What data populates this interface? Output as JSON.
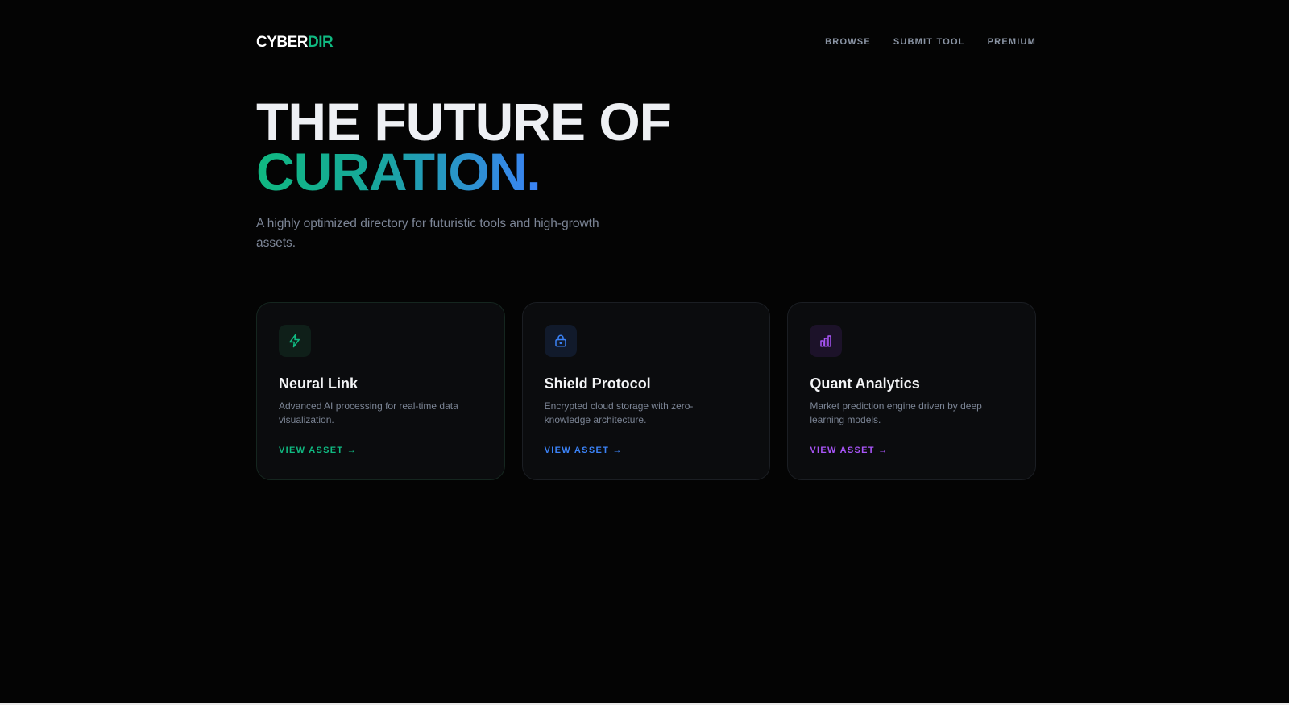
{
  "brand": {
    "logo_primary": "CYBER",
    "logo_accent": "DIR",
    "accent_color": "#10b981"
  },
  "nav": {
    "items": [
      {
        "label": "BROWSE"
      },
      {
        "label": "SUBMIT TOOL"
      },
      {
        "label": "PREMIUM"
      }
    ]
  },
  "hero": {
    "title_line1": "THE FUTURE OF",
    "title_line2": "CURATION.",
    "subtitle": "A highly optimized directory for futuristic tools and high-growth assets.",
    "gradient_colors": [
      "#10b981",
      "#3b82f6"
    ]
  },
  "cards": [
    {
      "icon": "lightning-icon",
      "title": "Neural Link",
      "description": "Advanced AI processing for real-time data visualization.",
      "link_label": "VIEW ASSET →",
      "accent_color": "#10b981",
      "icon_bg": "#0f1f19"
    },
    {
      "icon": "lock-icon",
      "title": "Shield Protocol",
      "description": "Encrypted cloud storage with zero-knowledge architecture.",
      "link_label": "VIEW ASSET →",
      "accent_color": "#3b82f6",
      "icon_bg": "#111a2b"
    },
    {
      "icon": "bar-chart-icon",
      "title": "Quant Analytics",
      "description": "Market prediction engine driven by deep learning models.",
      "link_label": "VIEW ASSET →",
      "accent_color": "#a855f7",
      "icon_bg": "#1c1229"
    }
  ]
}
